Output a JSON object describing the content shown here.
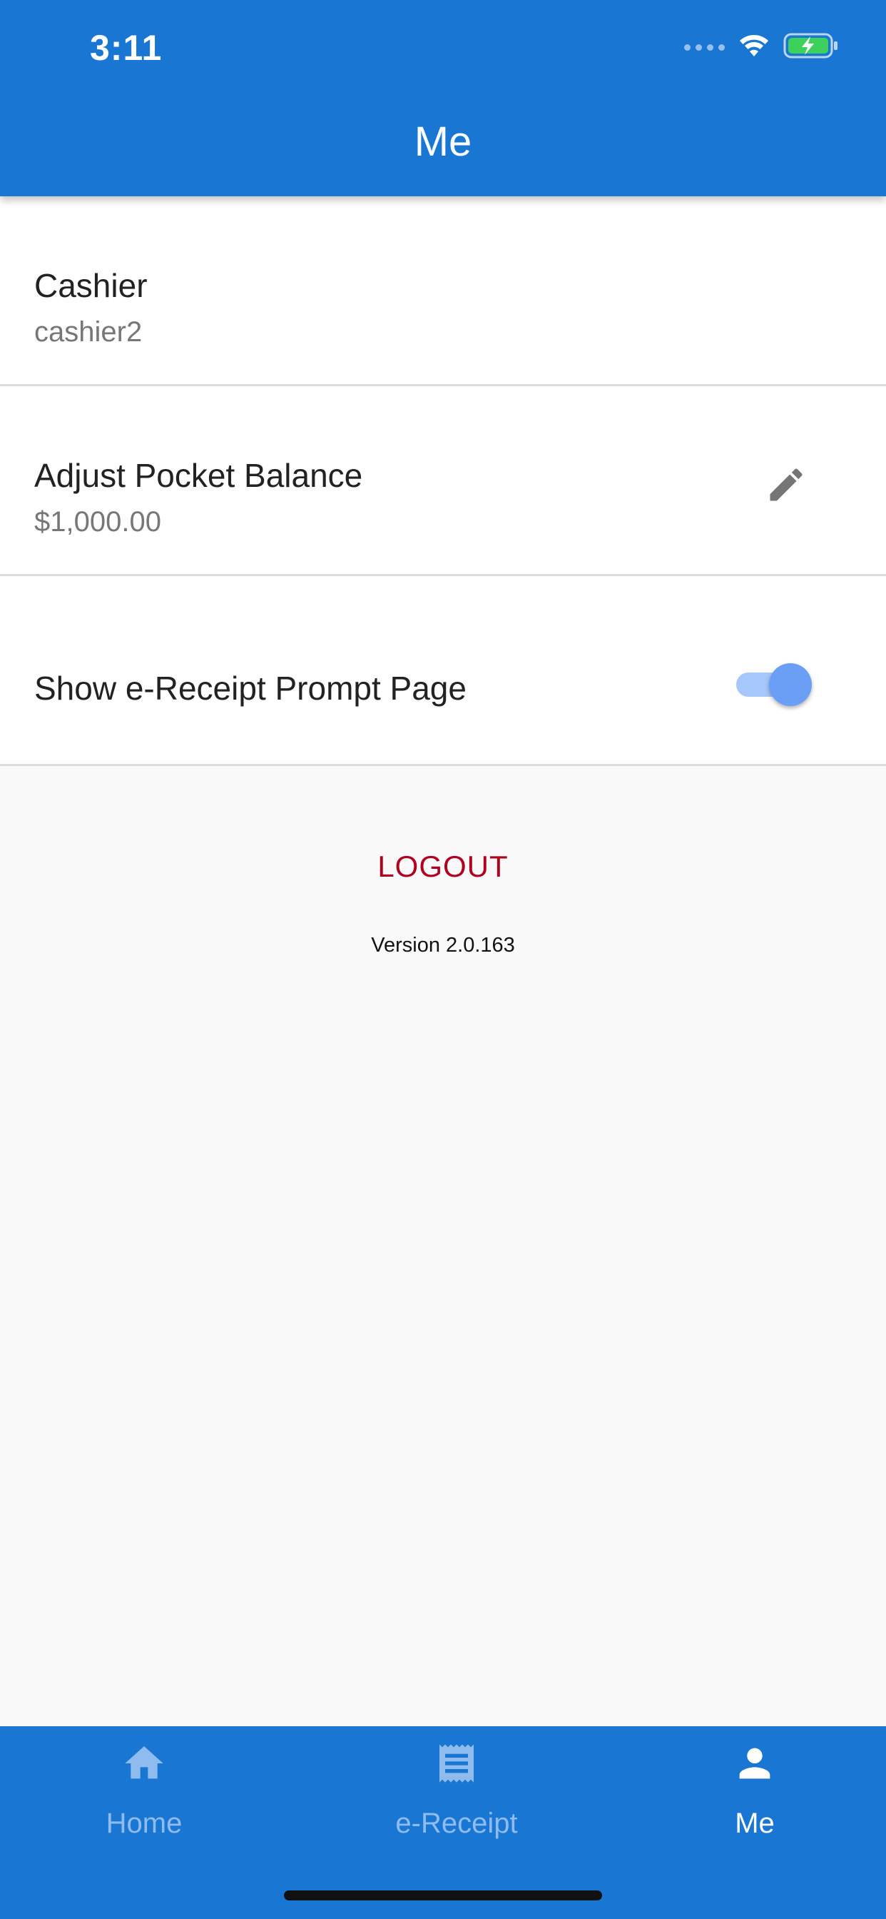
{
  "status_bar": {
    "time": "3:11"
  },
  "header": {
    "title": "Me"
  },
  "profile": {
    "role": "Cashier",
    "username": "cashier2"
  },
  "pocket_balance": {
    "label": "Adjust Pocket Balance",
    "value": "$1,000.00",
    "edit_icon": "pencil-icon"
  },
  "ereceipt_setting": {
    "label": "Show e-Receipt Prompt Page",
    "enabled": true
  },
  "logout": {
    "label": "LOGOUT"
  },
  "version": {
    "text": "Version 2.0.163"
  },
  "bottom_nav": {
    "items": [
      {
        "label": "Home",
        "icon": "home-icon",
        "active": false
      },
      {
        "label": "e-Receipt",
        "icon": "receipt-icon",
        "active": false
      },
      {
        "label": "Me",
        "icon": "person-icon",
        "active": true
      }
    ]
  },
  "colors": {
    "primary": "#1976d2",
    "logout": "#b00020",
    "toggle_thumb": "#6a9ff5",
    "toggle_track": "#a6c7f9"
  }
}
